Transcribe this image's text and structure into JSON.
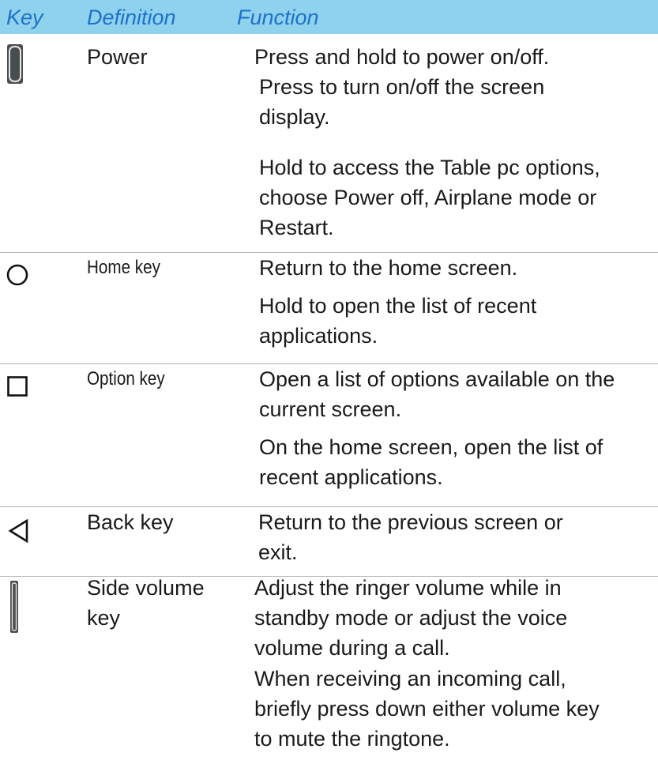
{
  "header": {
    "key": "Key",
    "definition": "Definition",
    "function": "Function"
  },
  "rows": [
    {
      "icon": "power-button-icon",
      "definition": "Power",
      "functions": [
        "Press and hold to power on/off.",
        "Press to turn on/off the screen\ndisplay.",
        "Hold to access the Table pc options,\nchoose Power off, Airplane mode or\nRestart."
      ]
    },
    {
      "icon": "home-circle-icon",
      "definition": "Home key",
      "functions": [
        "Return to the home screen.",
        "Hold to open the list of recent\napplications."
      ]
    },
    {
      "icon": "option-square-icon",
      "definition": "Option key",
      "functions": [
        "Open a list of options available on the\ncurrent screen.",
        "On the home screen, open the list of\nrecent applications."
      ]
    },
    {
      "icon": "back-triangle-icon",
      "definition": "Back key",
      "functions": [
        "Return to the previous screen or\nexit."
      ]
    },
    {
      "icon": "volume-key-icon",
      "definition": "Side volume\nkey",
      "functions": [
        "Adjust the ringer volume while in\nstandby mode or adjust the voice\nvolume during a call.",
        "When receiving an incoming call,\nbriefly press down either volume key\nto mute the ringtone."
      ]
    }
  ]
}
